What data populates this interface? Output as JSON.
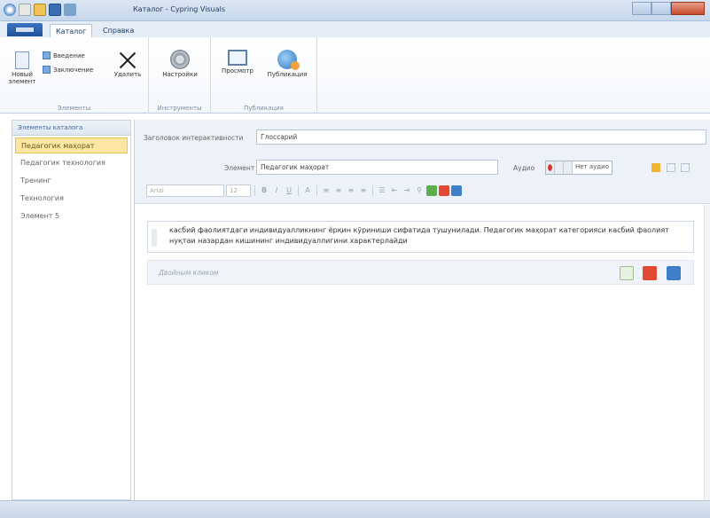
{
  "window": {
    "title": "Каталог - Сypring Visuals"
  },
  "tabs": [
    {
      "label": "Каталог"
    },
    {
      "label": "Справка"
    }
  ],
  "ribbon": {
    "groups": {
      "elements": {
        "label": "Элементы",
        "new_element": "Новый элемент",
        "introduction": "Введение",
        "conclusion": "Заключение",
        "delete": "Удалить"
      },
      "tools": {
        "label": "Инструменты",
        "settings": "Настройки"
      },
      "publish": {
        "label": "Публикация",
        "preview": "Просмотр",
        "publish": "Публикация"
      }
    }
  },
  "sidebar": {
    "header": "Элементы каталога",
    "items": [
      {
        "label": "Педагогик маҳорат"
      },
      {
        "label": "Педагогик технология"
      },
      {
        "label": "Тренинг"
      },
      {
        "label": "Технология"
      },
      {
        "label": "Элемент 5"
      }
    ]
  },
  "form": {
    "interactivity_title_label": "Заголовок интерактивности",
    "interactivity_title_value": "Глоссарий",
    "element_label": "Элемент",
    "element_value": "Педагогик маҳорат",
    "audio_label": "Аудио",
    "audio_value": "Нет аудио",
    "font_placeholder": "Arial",
    "font_size": "12"
  },
  "content": {
    "paragraph": "касбий фаолиятдаги индивидуалликнинг ёрқин кўриниши сифатида тушунилади. Педагогик маҳорат категорияси касбий фаолият нуқтаи назардан кишининг индивидуаллигини характерлайди",
    "add_text_placeholder": "Двойным кликом"
  },
  "colors": {
    "selected_item_bg": "#fbe7a3",
    "ribbon_bg": "#ffffff",
    "form_bg": "#edf2f8"
  }
}
